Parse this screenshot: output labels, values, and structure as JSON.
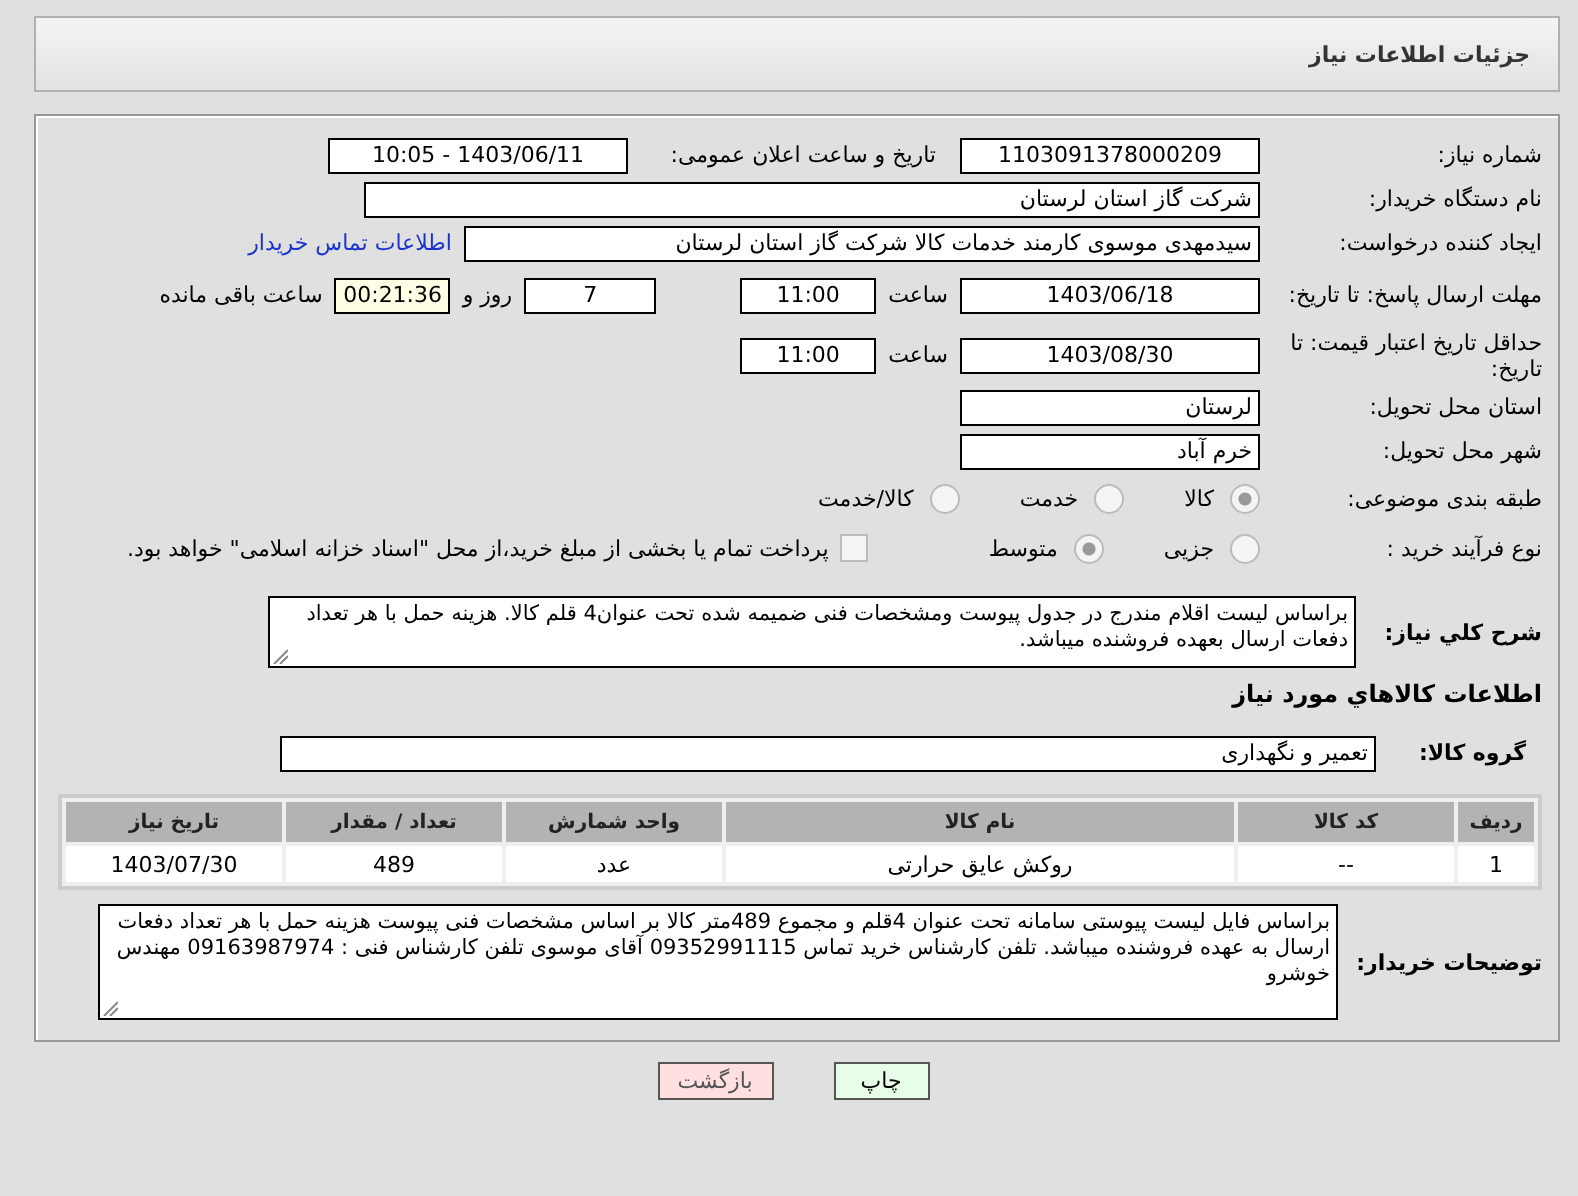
{
  "page_title": "جزئیات اطلاعات نیاز",
  "need_number": {
    "label": "شماره نیاز:",
    "value": "1103091378000209"
  },
  "announce": {
    "label": "تاریخ و ساعت اعلان عمومی:",
    "value": "1403/06/11 - 10:05"
  },
  "buyer_org": {
    "label": "نام دستگاه خریدار:",
    "value": "شرکت گاز استان لرستان"
  },
  "requester": {
    "label": "ایجاد کننده درخواست:",
    "value": "سیدمهدی موسوی کارمند خدمات کالا شرکت گاز استان لرستان",
    "link": "اطلاعات تماس خریدار"
  },
  "reply_deadline": {
    "label": "مهلت ارسال پاسخ: تا تاریخ:",
    "date": "1403/06/18",
    "time_label": "ساعت",
    "time": "11:00",
    "days": "7",
    "days_label": "روز و",
    "remaining": "00:21:36",
    "remaining_label": "ساعت باقی مانده"
  },
  "price_validity": {
    "label": "حداقل تاریخ اعتبار قیمت: تا تاریخ:",
    "date": "1403/08/30",
    "time_label": "ساعت",
    "time": "11:00"
  },
  "province": {
    "label": "استان محل تحویل:",
    "value": "لرستان"
  },
  "city": {
    "label": "شهر محل تحویل:",
    "value": "خرم آباد"
  },
  "category": {
    "label": "طبقه بندی موضوعی:",
    "options": [
      {
        "label": "کالا",
        "selected": true
      },
      {
        "label": "خدمت",
        "selected": false
      },
      {
        "label": "کالا/خدمت",
        "selected": false
      }
    ]
  },
  "purchase_process": {
    "label": "نوع فرآیند خرید :",
    "options": [
      {
        "label": "جزیی",
        "selected": false
      },
      {
        "label": "متوسط",
        "selected": true
      }
    ],
    "payment": {
      "label": "پرداخت تمام یا بخشی از مبلغ خرید،از محل \"اسناد خزانه اسلامی\" خواهد بود.",
      "checked": false
    }
  },
  "description": {
    "label": "شرح کلي نياز:",
    "value": "براساس لیست اقلام مندرج در جدول پیوست ومشخصات فنی ضمیمه شده تحت عنوان4 قلم کالا. هزینه حمل با هر تعداد دفعات ارسال بعهده فروشنده میباشد."
  },
  "goods_heading": "اطلاعات كالاهاي مورد نياز",
  "goods_group": {
    "label": "گروه کالا:",
    "value": "تعمیر و نگهداری"
  },
  "table": {
    "columns": [
      "ردیف",
      "کد کالا",
      "نام کالا",
      "واحد شمارش",
      "تعداد / مقدار",
      "تاریخ نیاز"
    ],
    "rows": [
      [
        "1",
        "--",
        "روکش عایق حرارتی",
        "عدد",
        "489",
        "1403/07/30"
      ]
    ]
  },
  "buyer_notes": {
    "label": "توضیحات خریدار:",
    "value": "براساس  فایل لیست پیوستی سامانه تحت عنوان 4قلم و مجموع 489متر کالا بر اساس مشخصات فنی پیوست هزینه حمل با هر تعداد دفعات ارسال به عهده فروشنده میباشد. تلفن کارشناس خرید تماس 09352991115 آقای موسوی تلفن کارشناس فنی : 09163987974 مهندس خوشرو"
  },
  "buttons": [
    {
      "label": "چاپ",
      "kind": "print"
    },
    {
      "label": "بازگشت",
      "kind": "back"
    }
  ]
}
